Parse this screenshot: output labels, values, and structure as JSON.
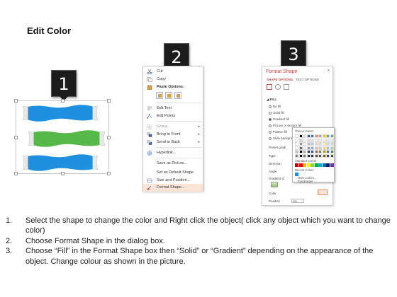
{
  "title": "Edit Color",
  "steps": [
    {
      "number": "1"
    },
    {
      "number": "2"
    },
    {
      "number": "3"
    }
  ],
  "shapes": {
    "bands": [
      {
        "color": "#1f8fdf"
      },
      {
        "color": "#56b848"
      },
      {
        "color": "#1f8fdf"
      }
    ]
  },
  "context_menu": {
    "items": [
      {
        "label": "Cut"
      },
      {
        "label": "Copy"
      },
      {
        "label": "Paste Options:"
      },
      {
        "label": "Edit Text"
      },
      {
        "label": "Edit Points"
      },
      {
        "label": "Group"
      },
      {
        "label": "Bring to Front"
      },
      {
        "label": "Send to Back"
      },
      {
        "label": "Hyperlink..."
      },
      {
        "label": "Save as Picture..."
      },
      {
        "label": "Set as Default Shape"
      },
      {
        "label": "Size and Position..."
      },
      {
        "label": "Format Shape..."
      }
    ]
  },
  "format_pane": {
    "title": "Format Shape",
    "close": "x",
    "tab_shape": "SHAPE OPTIONS",
    "tab_text": "TEXT OPTIONS",
    "fill_header": "◢ FILL",
    "options": [
      "No fill",
      "Solid fill",
      "Gradient fill",
      "Picture or texture fill",
      "Pattern fill",
      "Slide background fill"
    ],
    "labels": [
      "Preset gradi",
      "Type",
      "Direction",
      "Angle",
      "Gradient st",
      "Color",
      "Position"
    ],
    "position_value": "0%"
  },
  "color_popup": {
    "theme_header": "Theme Colors",
    "standard_header": "Standard Colors",
    "recent_header": "Recent Colors",
    "more_colors": "More Colors...",
    "eyedropper": "Eyedropper",
    "theme_row": [
      "#ffffff",
      "#000000",
      "#e7e6e6",
      "#44546a",
      "#4472c4",
      "#ed7d31",
      "#a5a5a5",
      "#ffc000",
      "#5b9bd5",
      "#70ad47"
    ],
    "standard_row": [
      "#c00000",
      "#ff0000",
      "#ffc000",
      "#ffff00",
      "#92d050",
      "#00b050",
      "#00b0f0",
      "#0070c0",
      "#002060",
      "#7030a0"
    ],
    "recent_row": [
      "#1f8fdf"
    ]
  },
  "instructions": [
    {
      "num": "1.",
      "text": "Select the shape to change the color and Right click the object( click any object which you want to change color)"
    },
    {
      "num": "2.",
      "text": "Choose Format Shape in the dialog box."
    },
    {
      "num": "3.",
      "text": "Choose “Fill” in the Format Shape box then “Solid” or “Gradient” depending on the appearance of the object. Change colour as shown in the picture."
    }
  ]
}
